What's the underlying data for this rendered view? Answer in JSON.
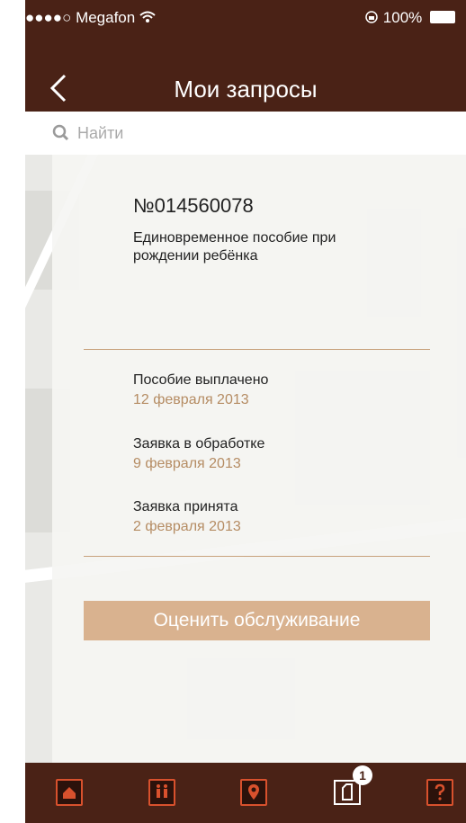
{
  "status_bar": {
    "carrier": "●●●●○ Megafon",
    "battery": "100%"
  },
  "header": {
    "title": "Мои запросы"
  },
  "search": {
    "placeholder": "Найти"
  },
  "request": {
    "number": "№014560078",
    "type": "Единовременное пособие при рождении ребёнка",
    "events": [
      {
        "title": "Пособие выплачено",
        "date": "12 февраля 2013"
      },
      {
        "title": "Заявка в обработке",
        "date": "9 февраля 2013"
      },
      {
        "title": "Заявка принята",
        "date": "2 февраля 2013"
      }
    ]
  },
  "actions": {
    "rate_label": "Оценить обслуживание"
  },
  "tabbar": {
    "badge_count": "1",
    "icons": [
      "home-icon",
      "people-icon",
      "location-pin-icon",
      "documents-icon",
      "help-icon"
    ]
  },
  "colors": {
    "header_bg": "#4a2216",
    "accent": "#d8512d",
    "divider": "#c8a27d",
    "date_text": "#b58c63",
    "button_bg": "#d9b28f"
  }
}
